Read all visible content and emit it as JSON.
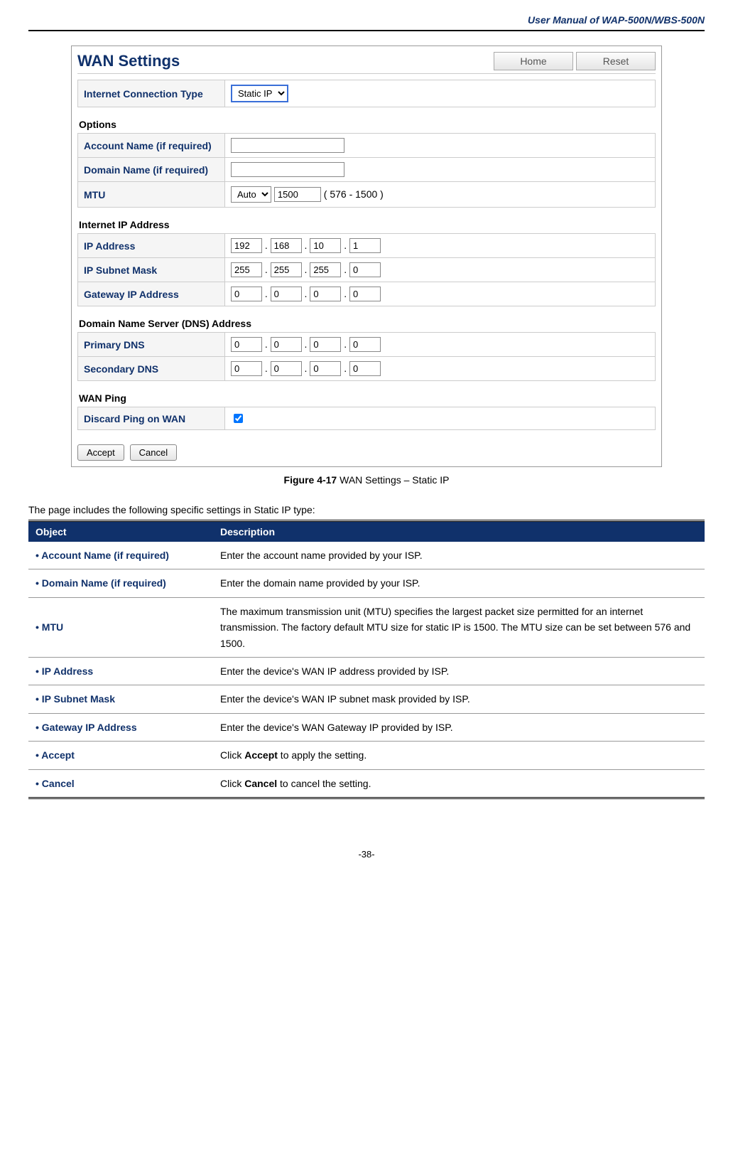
{
  "header": "User Manual of WAP-500N/WBS-500N",
  "screenshot": {
    "title": "WAN Settings",
    "buttons": {
      "home": "Home",
      "reset": "Reset"
    },
    "ict": {
      "label": "Internet Connection Type",
      "value": "Static IP"
    },
    "options_heading": "Options",
    "account_name_label": "Account Name (if required)",
    "domain_name_label": "Domain Name (if required)",
    "mtu": {
      "label": "MTU",
      "mode": "Auto",
      "value": "1500",
      "range": "( 576 - 1500 )"
    },
    "iip_heading": "Internet IP Address",
    "ip_address": {
      "label": "IP Address",
      "o": [
        "192",
        "168",
        "10",
        "1"
      ]
    },
    "subnet": {
      "label": "IP Subnet Mask",
      "o": [
        "255",
        "255",
        "255",
        "0"
      ]
    },
    "gateway": {
      "label": "Gateway IP Address",
      "o": [
        "0",
        "0",
        "0",
        "0"
      ]
    },
    "dns_heading": "Domain Name Server (DNS) Address",
    "pdns": {
      "label": "Primary DNS",
      "o": [
        "0",
        "0",
        "0",
        "0"
      ]
    },
    "sdns": {
      "label": "Secondary DNS",
      "o": [
        "0",
        "0",
        "0",
        "0"
      ]
    },
    "wanping_heading": "WAN Ping",
    "discard_label": "Discard Ping on WAN",
    "accept": "Accept",
    "cancel": "Cancel"
  },
  "caption": {
    "fig": "Figure 4-17",
    "text": " WAN Settings – Static IP"
  },
  "intro": "The page includes the following specific settings in Static IP type:",
  "table": {
    "head_obj": "Object",
    "head_desc": "Description",
    "rows": [
      {
        "obj": "Account Name (if required)",
        "desc": "Enter the account name provided by your ISP."
      },
      {
        "obj": "Domain Name (if required)",
        "desc": "Enter the domain name provided by your ISP."
      },
      {
        "obj": "MTU",
        "desc": "The maximum transmission unit (MTU) specifies the largest packet size permitted for an internet transmission. The factory default MTU size for static IP is 1500. The MTU size can be set between 576 and 1500."
      },
      {
        "obj": "IP Address",
        "desc": "Enter the device's WAN IP address provided by ISP."
      },
      {
        "obj": "IP Subnet Mask",
        "desc": "Enter the device's WAN IP subnet mask provided by ISP."
      },
      {
        "obj": "Gateway IP Address",
        "desc": "Enter the device's WAN Gateway IP provided by ISP."
      },
      {
        "obj": "Accept",
        "desc_pre": "Click ",
        "desc_bold": "Accept",
        "desc_post": " to apply the setting."
      },
      {
        "obj": "Cancel",
        "desc_pre": "Click ",
        "desc_bold": "Cancel",
        "desc_post": " to cancel the setting."
      }
    ]
  },
  "page_num": "-38-"
}
